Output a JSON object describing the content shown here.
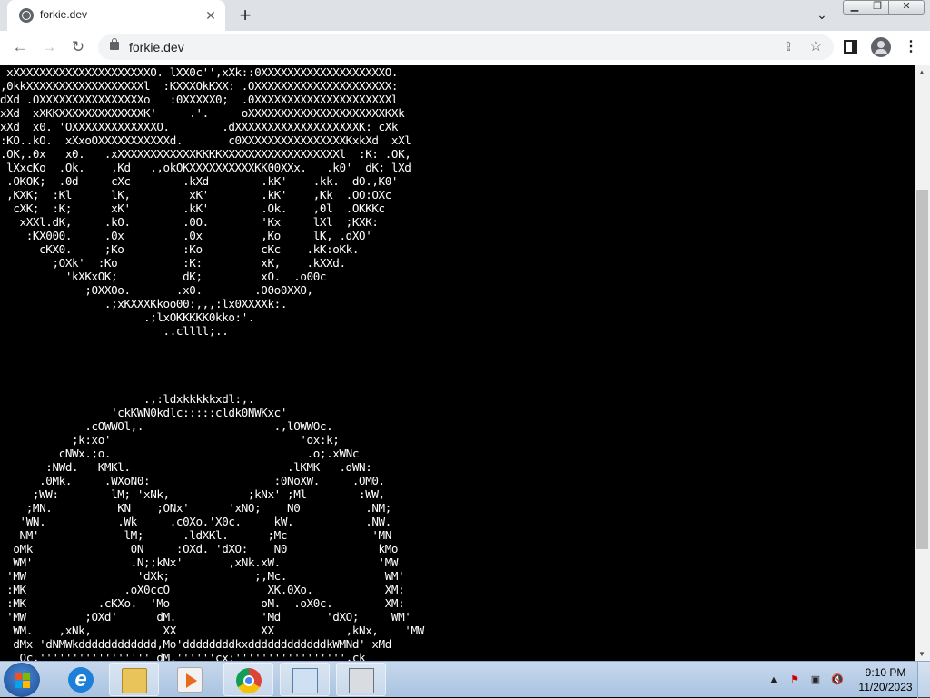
{
  "browser": {
    "tab": {
      "title": "forkie.dev",
      "favicon": "globe-icon",
      "close_icon": "close-icon"
    },
    "new_tab_icon": "plus-icon",
    "tab_search_icon": "chevron-down-icon",
    "omnibox": {
      "url": "forkie.dev",
      "lock_icon": "lock-icon",
      "share_icon": "share-icon",
      "bookmark_icon": "star-icon"
    },
    "nav": {
      "back_icon": "arrow-left-icon",
      "forward_icon": "arrow-right-icon",
      "reload_icon": "reload-icon"
    }
  },
  "page": {
    "ascii_art": " xXXXXXXXXXXXXXXXXXXXXXO. lXX0c'',xXk::0XXXXXXXXXXXXXXXXXXXO.\n,0kkXXXXXXXXXXXXXXXXXXl  :KXXXOkKXX: .OXXXXXXXXXXXXXXXXXXXXX:\ndXd .OXXXXXXXXXXXXXXXXo   :0XXXXX0;  .0XXXXXXXXXXXXXXXXXXXXXl\nxXd  xXKKXXXXXXXXXXXXXK'     .'.     oXXXXXXXXXXXXXXXXXXXXXKXk\nxXd  x0. 'OXXXXXXXXXXXXXO.        .dXXXXXXXXXXXXXXXXXXXK: cXk\n:KO..kO.  xXxoOXXXXXXXXXXXd.       c0XXXXXXXXXXXXXXXXKxkXd  xXl\n.OK,.0x   x0.   .xXXXXXXXXXXXXKKKKXXXXXXXXXXXXXXXXXXl  :K: .OK,\n lXxcKo  .Ok.    ,Kd   .,okOKXXXXXXXXXXKK00XXx.   .k0'  dK; lXd\n .OKOK;  .0d     cXc        .kXd        .kK'    .kk.  dO.,K0'\n ,KXK;  :Kl      lK,         xK'        .kK'    ,Kk  .OO:OXc\n  cXK;  :K;      xK'        .kK'        .Ok.    ,0l  .OKKKc\n   xXXl.dK,     .kO.        .0O.        'Kx     lXl  ;KXK:\n    :KX000.     .0x         .0x         ,Ko     lK, .dXO'\n      cKX0.     ;Ko         :Ko         cKc    .kK:oKk.\n        ;OXk'  :Ko          :K:         xK,    .kXXd.\n          'kXKxOK;          dK;         xO.  .o00c\n             ;OXXOo.       .x0.        .O0o0XXO,\n                .;xKXXXKkoo00:,,,:lx0XXXXk:.\n                      .;lxOKKKKK0kko:'.\n                         ..cllll;..\n\n\n\n\n                      .,:ldxkkkkkxdl:,.\n                 'ckKWN0kdlc:::::cldk0NWKxc'\n             .cOWWOl,.                    .,lOWWOc.\n           ;k:xo'                             'ox:k;\n         cNWx.;o.                              .o;.xWNc\n       :NWd.   KMKl.                        .lKMK   .dWN:\n      .0Mk.     .WXoN0:                   :0NoXW.     .OM0.\n     ;WW:        lM; 'xNk,            ;kNx' ;Ml        :WW,\n    ;MN.          KN    ;ONx'      'xNO;    N0          .NM;\n   'WN.           .Wk     .c0Xo.'X0c.     kW.           .NW.\n   NM'             lM;      .ldXKl.      ;Mc             'MN\n  oMk               0N     :OXd. 'dXO:    N0              kMo\n  WM'               .N;;kNx'       ,xNk.xW.               'MW\n 'MW                 'dXk;             ;,Mc.               WM'\n :MK               .oX0ccO               XK.0Xo.           XM:\n :MK           .cKXo.  'Mo              oM.  .oX0c.        XM:\n 'MW         ;OXd'      dM.             'Md       'dXO;     WM'\n  WM.    ,xNk,           XX             XX           ,kNx,    'MW\n  dMx 'dNMWkdddddddddddd,Mo'ddddddddkxddddddddddddkWMNd' xMd\n   Oc,''''''''''''''''' dM,''''''cx:''''''''''''''''',ck"
  },
  "taskbar": {
    "start_icon": "windows-start-icon",
    "items": [
      {
        "icon": "internet-explorer-icon"
      },
      {
        "icon": "folder-icon"
      },
      {
        "icon": "media-player-icon"
      },
      {
        "icon": "chrome-icon"
      },
      {
        "icon": "control-panel-icon"
      },
      {
        "icon": "network-icon"
      }
    ],
    "tray": {
      "time": "9:10 PM",
      "date": "11/20/2023"
    }
  },
  "colors": {
    "page_background": "#000000",
    "art_text": "#ffffff",
    "tabstrip": "#dee1e6",
    "taskbar": "#b9cfe8"
  }
}
